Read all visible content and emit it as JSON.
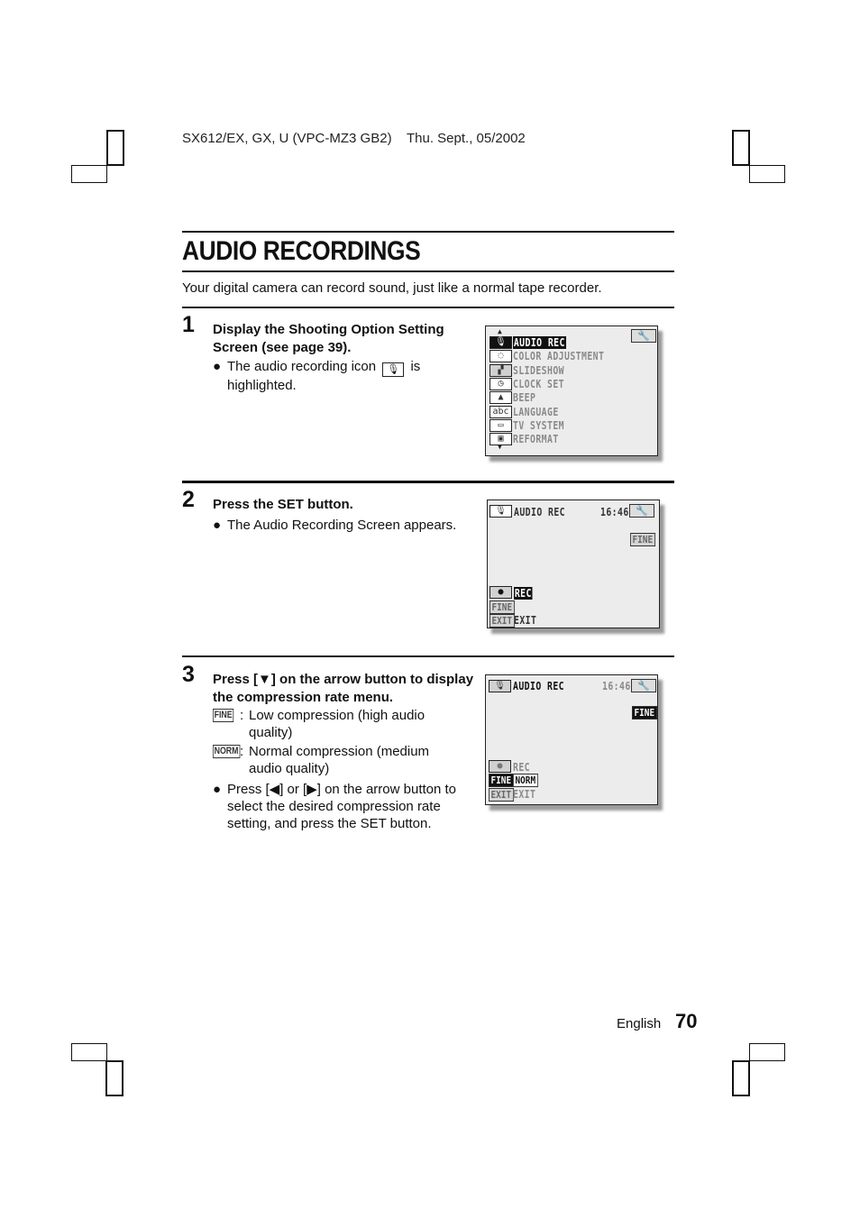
{
  "header": {
    "doc_id": "SX612/EX, GX, U (VPC-MZ3 GB2)",
    "date": "Thu. Sept., 05/2002"
  },
  "title": "AUDIO RECORDINGS",
  "intro": "Your digital camera can record sound, just like a normal tape recorder.",
  "steps": [
    {
      "number": "1",
      "heading": "Display the Shooting Option Setting Screen (see page 39).",
      "bullet_before_icon": "The audio recording icon",
      "bullet_icon": "microphone-icon",
      "bullet_after_icon": "is highlighted.",
      "screen": {
        "tool_icon": "wrench-icon",
        "menu": [
          {
            "icon": "microphone-icon",
            "glyph": "🎙",
            "label": "AUDIO REC",
            "selected": true
          },
          {
            "icon": "palette-icon",
            "glyph": "◌",
            "label": "COLOR ADJUSTMENT",
            "selected": false
          },
          {
            "icon": "slideshow-icon",
            "glyph": "▞",
            "label": "SLIDESHOW",
            "selected": false
          },
          {
            "icon": "clock-icon",
            "glyph": "◷",
            "label": "CLOCK SET",
            "selected": false
          },
          {
            "icon": "bell-icon",
            "glyph": "▲",
            "label": "BEEP",
            "selected": false
          },
          {
            "icon": "language-icon",
            "glyph": "abc",
            "label": "LANGUAGE",
            "selected": false
          },
          {
            "icon": "tv-icon",
            "glyph": "▭",
            "label": "TV SYSTEM",
            "selected": false
          },
          {
            "icon": "reformat-icon",
            "glyph": "▣",
            "label": "REFORMAT",
            "selected": false
          }
        ],
        "scroll_up": "▲",
        "scroll_down": "▼"
      }
    },
    {
      "number": "2",
      "heading": "Press the SET button.",
      "bullet": "The Audio Recording Screen appears.",
      "screen": {
        "mode_label": "AUDIO REC",
        "time": "16:46",
        "quality_badge": "FINE",
        "rec_label": "REC",
        "fine_label": "FINE",
        "exit_badge": "EXIT",
        "exit_label": "EXIT",
        "rec_glyph": "●"
      }
    },
    {
      "number": "3",
      "heading": "Press [▼] on the arrow button to display the compression rate menu.",
      "definitions": [
        {
          "tag": "FINE",
          "colon": ":",
          "text": "Low compression (high audio quality)"
        },
        {
          "tag": "NORM",
          "colon": ":",
          "text": "Normal compression (medium audio quality)"
        }
      ],
      "bullet": "Press [◀] or [▶] on the arrow button to select the desired compression rate setting, and press the SET button.",
      "screen": {
        "mode_label": "AUDIO REC",
        "time": "16:46",
        "quality_badge": "FINE",
        "rec_label": "REC",
        "fine_option": "FINE",
        "norm_option": "NORM",
        "exit_badge": "EXIT",
        "exit_label": "EXIT",
        "rec_glyph": "●"
      }
    }
  ],
  "footer": {
    "language": "English",
    "page_number": "70"
  },
  "bullet_glyph": "●",
  "wrench_glyph": "🔧"
}
